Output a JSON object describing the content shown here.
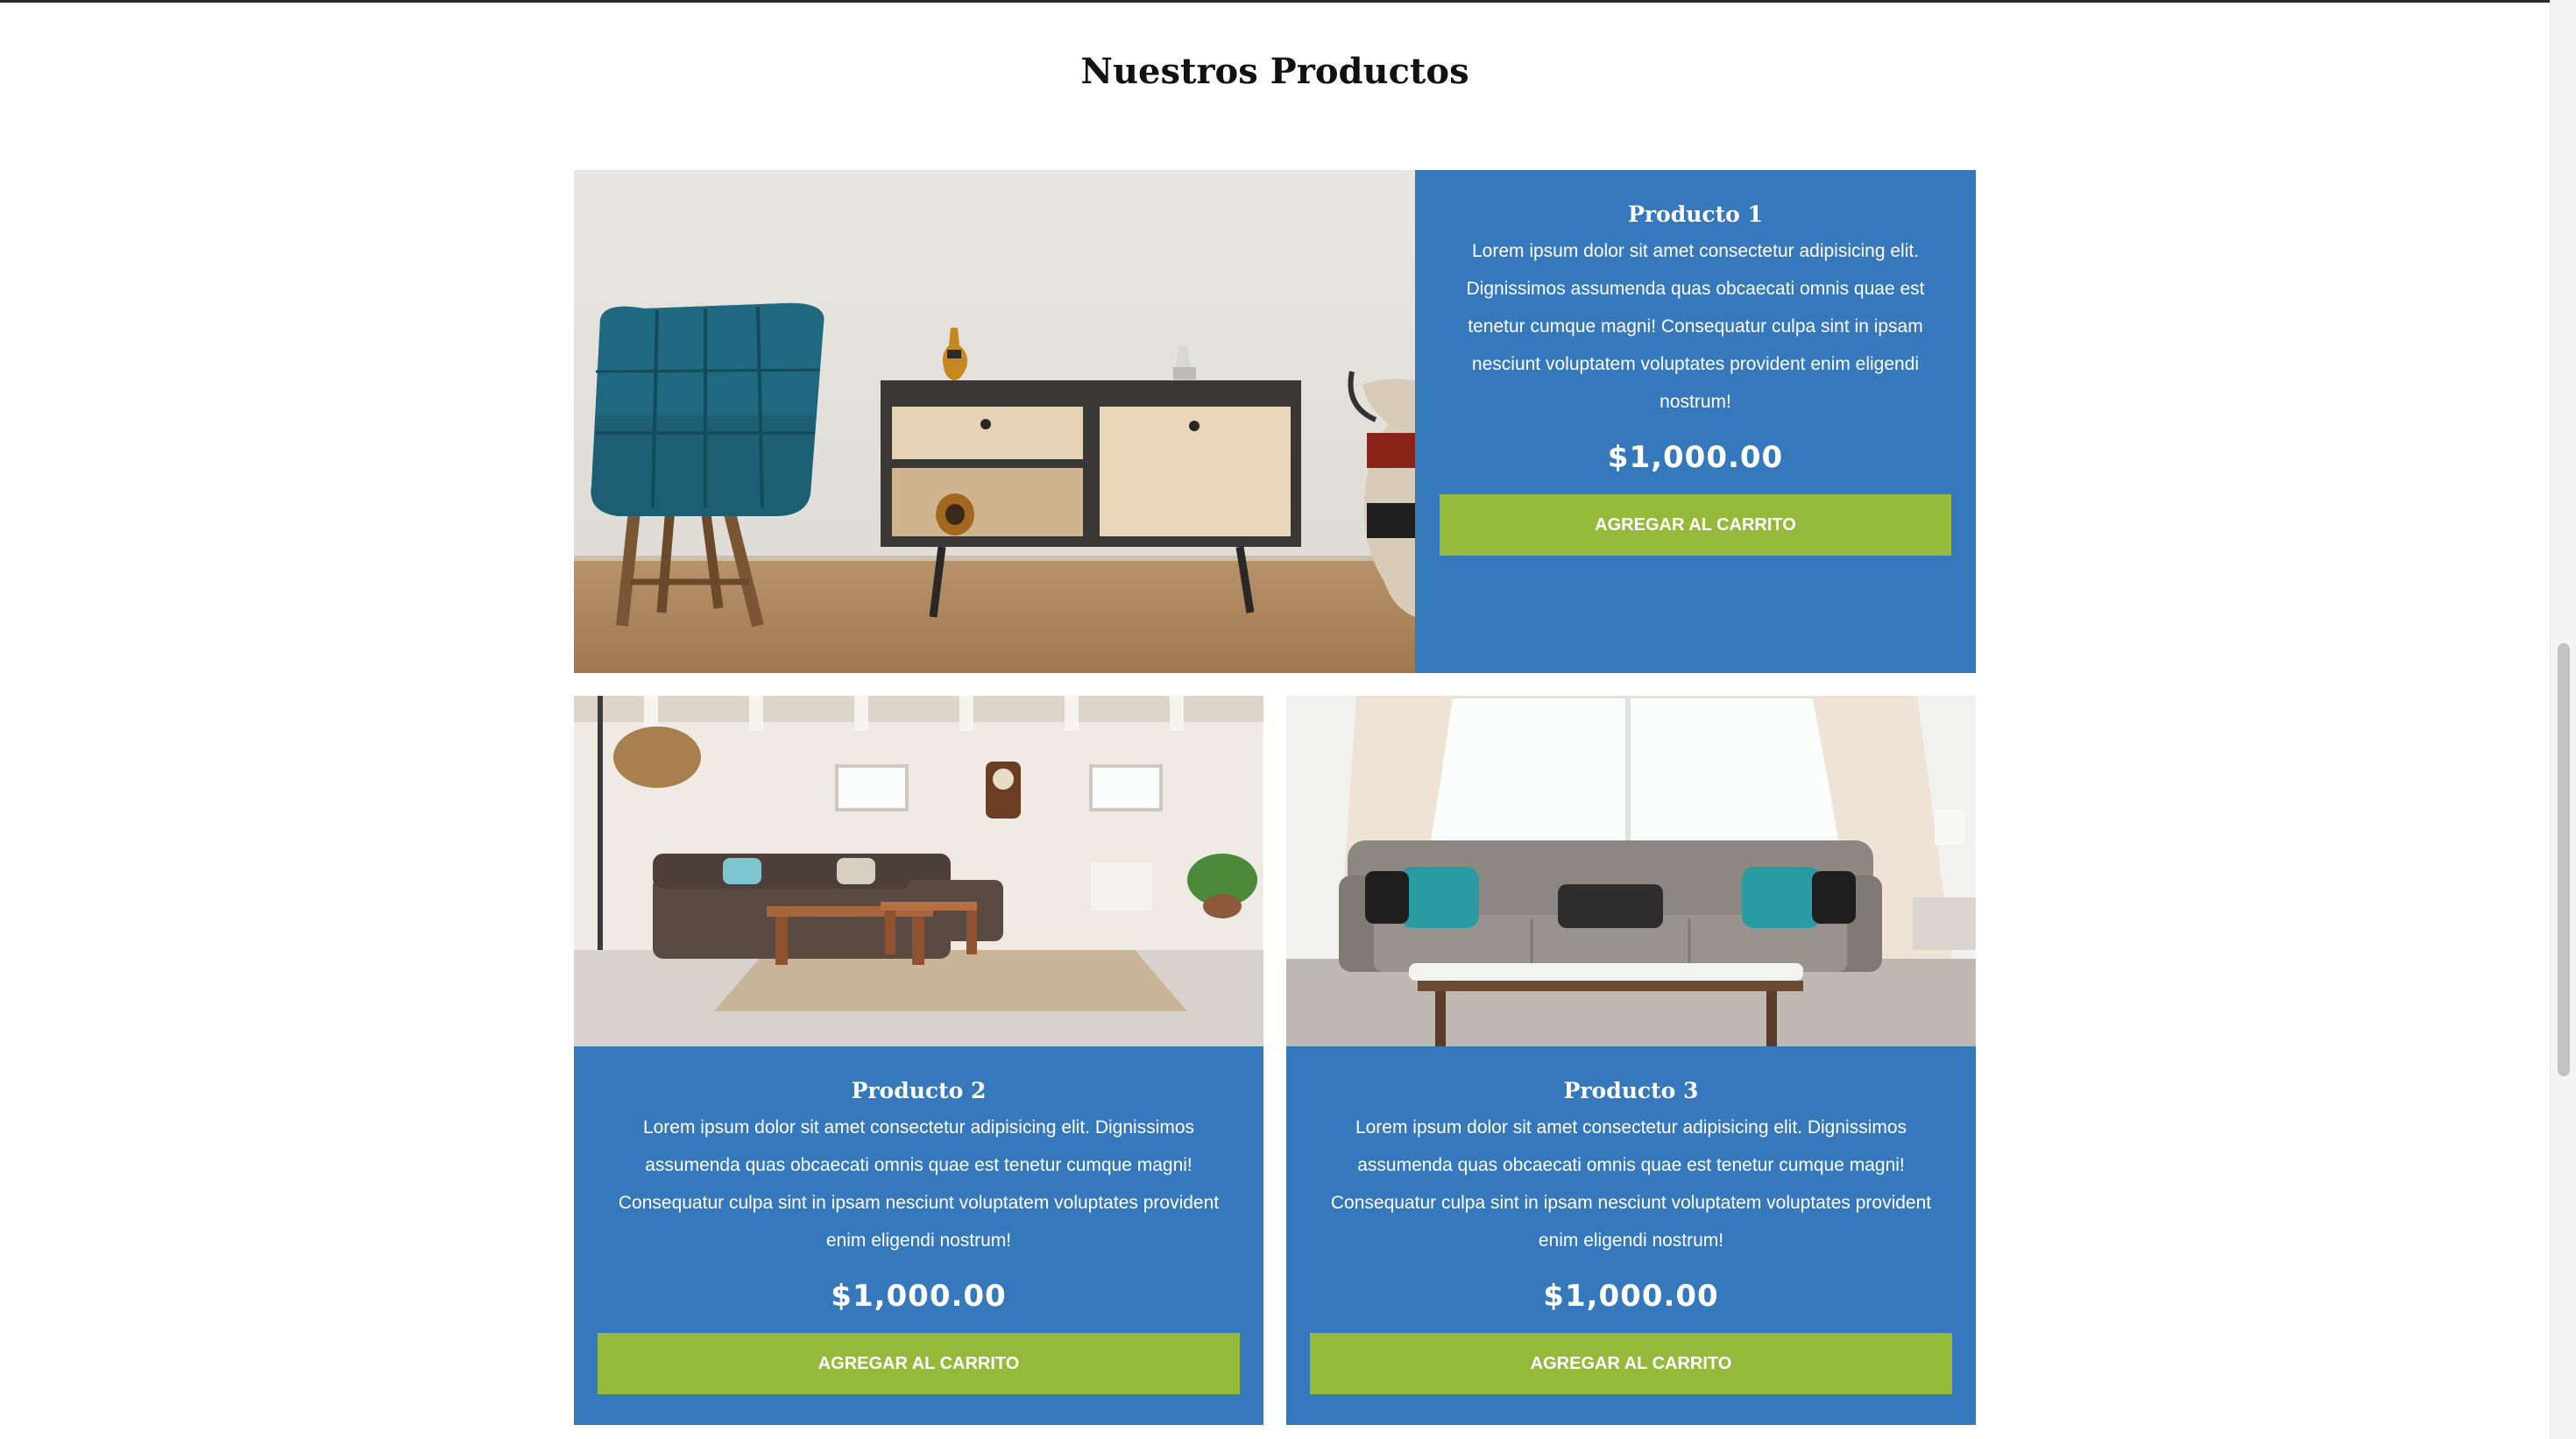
{
  "page": {
    "title": "Nuestros Productos"
  },
  "products": [
    {
      "title": "Producto 1",
      "description": "Lorem ipsum dolor sit amet consectetur adipisicing elit. Dignissimos assumenda quas obcaecati omnis quae est tenetur cumque magni! Consequatur culpa sint in ipsam nesciunt voluptatem voluptates provident enim eligendi nostrum!",
      "price": "$1,000.00",
      "button_label": "Agregar al Carrito"
    },
    {
      "title": "Producto 2",
      "description": "Lorem ipsum dolor sit amet consectetur adipisicing elit. Dignissimos assumenda quas obcaecati omnis quae est tenetur cumque magni! Consequatur culpa sint in ipsam nesciunt voluptatem voluptates provident enim eligendi nostrum!",
      "price": "$1,000.00",
      "button_label": "Agregar al Carrito"
    },
    {
      "title": "Producto 3",
      "description": "Lorem ipsum dolor sit amet consectetur adipisicing elit. Dignissimos assumenda quas obcaecati omnis quae est tenetur cumque magni! Consequatur culpa sint in ipsam nesciunt voluptatem voluptates provident enim eligendi nostrum!",
      "price": "$1,000.00",
      "button_label": "Agregar al Carrito"
    }
  ],
  "colors": {
    "card_background": "#3578bc",
    "button_background": "#95b93a",
    "text_on_card": "#ffffff"
  }
}
